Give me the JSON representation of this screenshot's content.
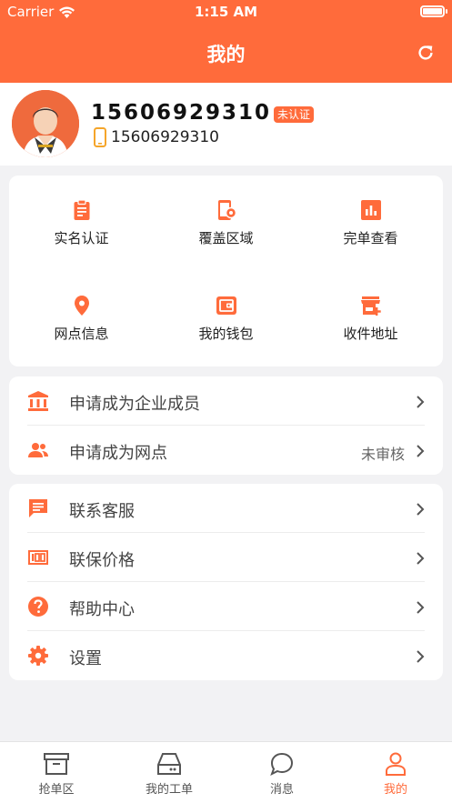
{
  "status": {
    "carrier": "Carrier",
    "time": "1:15 AM"
  },
  "header": {
    "title": "我的",
    "refresh_icon": "refresh-icon",
    "color": "#ff6b3b"
  },
  "profile": {
    "name": "15606929310",
    "badge": "未认证",
    "phone": "15606929310",
    "phone_icon": "mobile-phone-icon",
    "avatar_icon": "user-avatar-icon"
  },
  "grid": [
    {
      "label": "实名认证",
      "icon": "clipboard-icon"
    },
    {
      "label": "覆盖区域",
      "icon": "device-settings-icon"
    },
    {
      "label": "完单查看",
      "icon": "bar-chart-icon"
    },
    {
      "label": "网点信息",
      "icon": "location-pin-icon"
    },
    {
      "label": "我的钱包",
      "icon": "wallet-icon"
    },
    {
      "label": "收件地址",
      "icon": "store-add-icon"
    }
  ],
  "apply": [
    {
      "label": "申请成为企业成员",
      "value": "",
      "icon": "bank-icon"
    },
    {
      "label": "申请成为网点",
      "value": "未审核",
      "icon": "people-icon"
    }
  ],
  "menu": [
    {
      "label": "联系客服",
      "icon": "chat-message-icon"
    },
    {
      "label": "联保价格",
      "icon": "price-tag-icon"
    },
    {
      "label": "帮助中心",
      "icon": "help-icon"
    },
    {
      "label": "设置",
      "icon": "settings-gear-icon"
    }
  ],
  "tabs": [
    {
      "label": "抢单区",
      "icon": "inbox-box-icon",
      "active": false
    },
    {
      "label": "我的工单",
      "icon": "drive-tray-icon",
      "active": false
    },
    {
      "label": "消息",
      "icon": "chat-bubble-icon",
      "active": false
    },
    {
      "label": "我的",
      "icon": "person-icon",
      "active": true
    }
  ]
}
